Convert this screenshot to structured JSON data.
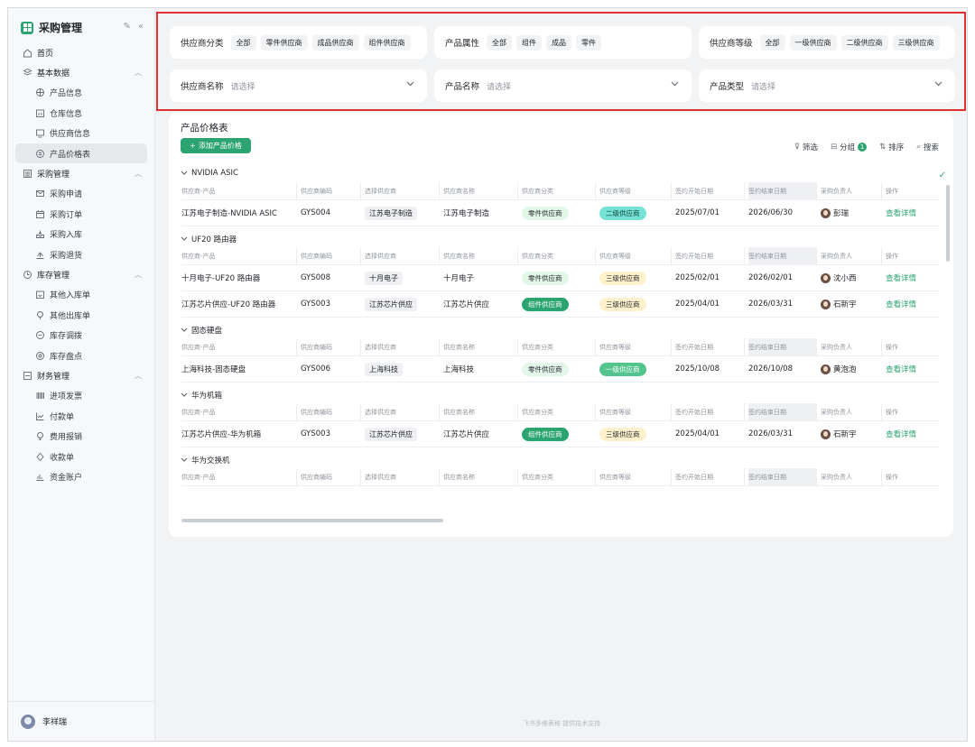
{
  "app": {
    "title": "采购管理",
    "user_name": "李祥瑞"
  },
  "nav": [
    {
      "label": "首页",
      "icon": "home-icon",
      "level": "top"
    },
    {
      "label": "基本数据",
      "icon": "layers-icon",
      "level": "group"
    },
    {
      "label": "产品信息",
      "icon": "globe-icon",
      "level": "sub"
    },
    {
      "label": "仓库信息",
      "icon": "warehouse-icon",
      "level": "sub"
    },
    {
      "label": "供应商信息",
      "icon": "monitor-icon",
      "level": "sub"
    },
    {
      "label": "产品价格表",
      "icon": "price-icon",
      "level": "sub",
      "active": true
    },
    {
      "label": "采购管理",
      "icon": "list-icon",
      "level": "group"
    },
    {
      "label": "采购申请",
      "icon": "mail-icon",
      "level": "sub"
    },
    {
      "label": "采购订单",
      "icon": "calendar-icon",
      "level": "sub"
    },
    {
      "label": "采购入库",
      "icon": "inbox-icon",
      "level": "sub"
    },
    {
      "label": "采购退货",
      "icon": "return-icon",
      "level": "sub"
    },
    {
      "label": "库存管理",
      "icon": "clock-icon",
      "level": "group"
    },
    {
      "label": "其他入库单",
      "icon": "stock-in-icon",
      "level": "sub"
    },
    {
      "label": "其他出库单",
      "icon": "stock-out-icon",
      "level": "sub"
    },
    {
      "label": "库存调拨",
      "icon": "transfer-icon",
      "level": "sub"
    },
    {
      "label": "库存盘点",
      "icon": "inventory-icon",
      "level": "sub"
    },
    {
      "label": "财务管理",
      "icon": "finance-icon",
      "level": "group"
    },
    {
      "label": "进项发票",
      "icon": "barcode-icon",
      "level": "sub"
    },
    {
      "label": "付款单",
      "icon": "chart-line-icon",
      "level": "sub"
    },
    {
      "label": "费用报销",
      "icon": "bulb-icon",
      "level": "sub"
    },
    {
      "label": "收款单",
      "icon": "diamond-icon",
      "level": "sub"
    },
    {
      "label": "资金账户",
      "icon": "bar-chart-icon",
      "level": "sub"
    }
  ],
  "filters": {
    "supplier_category": {
      "label": "供应商分类",
      "options": [
        "全部",
        "零件供应商",
        "成品供应商",
        "组件供应商"
      ]
    },
    "product_attr": {
      "label": "产品属性",
      "options": [
        "全部",
        "组件",
        "成品",
        "零件"
      ]
    },
    "supplier_level": {
      "label": "供应商等级",
      "options": [
        "全部",
        "一级供应商",
        "二级供应商",
        "三级供应商"
      ]
    },
    "supplier_name": {
      "label": "供应商名称",
      "placeholder": "请选择"
    },
    "product_name": {
      "label": "产品名称",
      "placeholder": "请选择"
    },
    "product_type": {
      "label": "产品类型",
      "placeholder": "请选择"
    }
  },
  "panel": {
    "title": "产品价格表",
    "add_label": "添加产品价格",
    "toolbar": {
      "filter": "筛选",
      "group": "分组",
      "group_count": "1",
      "sort": "排序",
      "search": "搜索"
    }
  },
  "columns": [
    "供应商-产品",
    "供应商编码",
    "选择供应商",
    "供应商名称",
    "供应商分类",
    "供应商等级",
    "签约开始日期",
    "签约结束日期",
    "采购负责人",
    "操作"
  ],
  "groups": [
    {
      "name": "NVIDIA ASIC",
      "rows": [
        {
          "product": "江苏电子制造-NVIDIA ASIC",
          "code": "GYS004",
          "select": "江苏电子制造",
          "supplier": "江苏电子制造",
          "category": "零件供应商",
          "category_style": "part",
          "level": "二级供应商",
          "level_style": "lv2",
          "start": "2025/07/01",
          "end": "2026/06/30",
          "owner": "彭瑞",
          "action": "查看详情"
        }
      ]
    },
    {
      "name": "UF20 路由器",
      "rows": [
        {
          "product": "十月电子-UF20 路由器",
          "code": "GYS008",
          "select": "十月电子",
          "supplier": "十月电子",
          "category": "零件供应商",
          "category_style": "part",
          "level": "三级供应商",
          "level_style": "lv3",
          "start": "2025/02/01",
          "end": "2026/02/01",
          "owner": "沈小西",
          "action": "查看详情"
        },
        {
          "product": "江苏芯片供应-UF20 路由器",
          "code": "GYS003",
          "select": "江苏芯片供应",
          "supplier": "江苏芯片供应",
          "category": "组件供应商",
          "category_style": "comp",
          "level": "三级供应商",
          "level_style": "lv3",
          "start": "2025/04/01",
          "end": "2026/03/31",
          "owner": "石新宇",
          "action": "查看详情"
        }
      ]
    },
    {
      "name": "固态硬盘",
      "rows": [
        {
          "product": "上海科技-固态硬盘",
          "code": "GYS006",
          "select": "上海科技",
          "supplier": "上海科技",
          "category": "零件供应商",
          "category_style": "part",
          "level": "一级供应商",
          "level_style": "lv1",
          "start": "2025/10/08",
          "end": "2026/10/08",
          "owner": "黄泡泡",
          "action": "查看详情"
        }
      ]
    },
    {
      "name": "华为机箱",
      "rows": [
        {
          "product": "江苏芯片供应-华为机箱",
          "code": "GYS003",
          "select": "江苏芯片供应",
          "supplier": "江苏芯片供应",
          "category": "组件供应商",
          "category_style": "comp",
          "level": "三级供应商",
          "level_style": "lv3",
          "start": "2025/04/01",
          "end": "2026/03/31",
          "owner": "石新宇",
          "action": "查看详情"
        }
      ]
    },
    {
      "name": "华为交换机",
      "rows": []
    }
  ],
  "footer": "飞书多维表格 提供技术支持"
}
